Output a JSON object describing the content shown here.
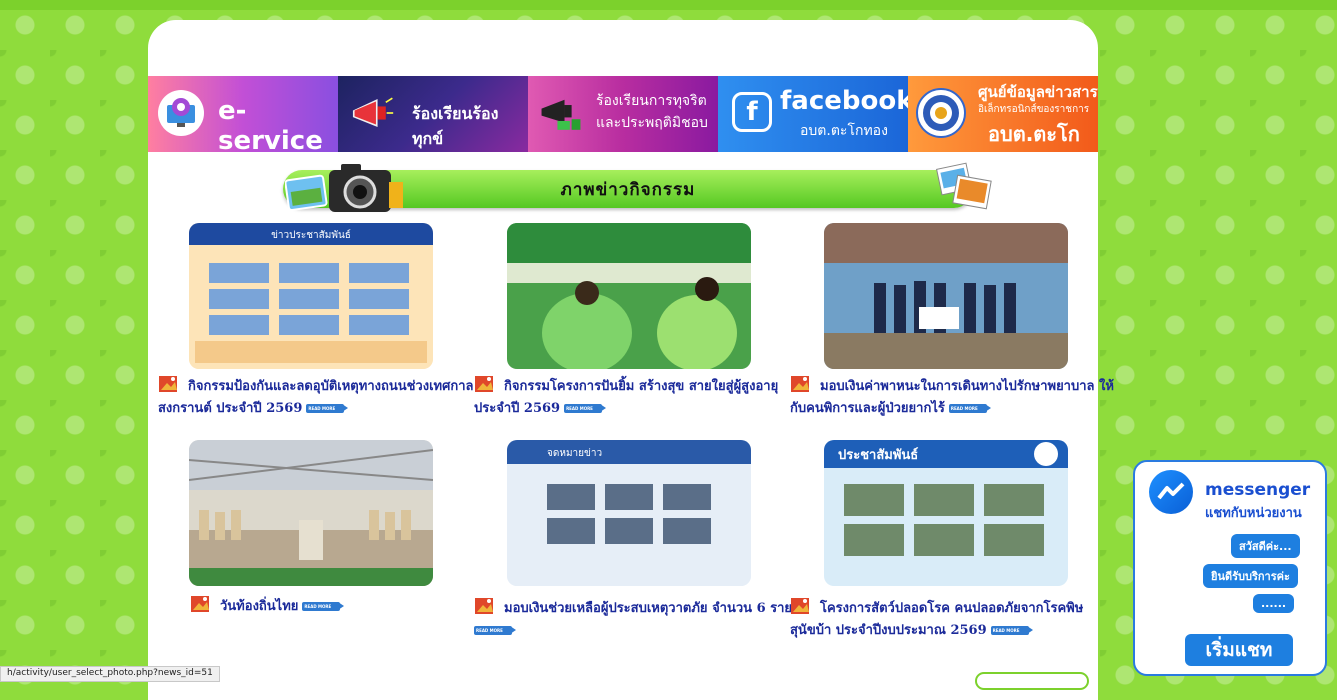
{
  "banners": [
    {
      "label": "e-service",
      "icon": "gear-monitor-icon"
    },
    {
      "label": "ร้องเรียนร้องทุกข์",
      "icon": "megaphone-icon"
    },
    {
      "line1": "ร้องเรียนการทุจริต",
      "line2": "และประพฤติมิชอบ",
      "icon": "megaphone-icon"
    },
    {
      "label": "facebook",
      "sub": "อบต.ตะโกทอง",
      "icon": "facebook-icon"
    },
    {
      "line1": "ศูนย์ข้อมูลข่าวสาร",
      "line2": "อิเล็กทรอนิกส์ของราชการ",
      "line3": "อบต.ตะโกทอง",
      "icon": "seal-icon"
    }
  ],
  "section": {
    "title": "ภาพข่าวกิจกรรม"
  },
  "news": [
    {
      "title": "กิจกรรมป้องกันและลดอุบัติเหตุทางถนนช่วงเทศกาลสงกรานต์ ประจำปี 2569",
      "read_more": "READ MORE"
    },
    {
      "title": "กิจกรรมโครงการปันยิ้ม สร้างสุข สายใยสู่ผู้สูงอายุ ประจำปี 2569",
      "read_more": "READ MORE"
    },
    {
      "title": "มอบเงินค่าพาหนะในการเดินทางไปรักษาพยาบาล ให้กับคนพิการและผู้ป่วยยากไร้",
      "read_more": "READ MORE"
    },
    {
      "title": "วันท้องถิ่นไทย",
      "read_more": "READ MORE"
    },
    {
      "title": "มอบเงินช่วยเหลือผู้ประสบเหตุวาตภัย จำนวน 6 ราย",
      "read_more": "READ MORE"
    },
    {
      "title": "โครงการสัตว์ปลอดโรค คนปลอดภัยจากโรคพิษสุนัขบ้า ประจำปีงบประมาณ 2569",
      "read_more": "READ MORE"
    }
  ],
  "thumb_texts": {
    "poster1": "ข่าวประชาสัมพันธ์",
    "poster2": "จดหมายข่าว",
    "poster3": "ประชาสัมพันธ์"
  },
  "messenger": {
    "title": "messenger",
    "subtitle": "แชทกับหน่วยงาน",
    "bubbles": [
      "สวัสดีค่ะ...",
      "ยินดีรับบริการค่ะ",
      "......"
    ],
    "start": "เริ่มแชท"
  },
  "status_url": "h/activity/user_select_photo.php?news_id=51"
}
